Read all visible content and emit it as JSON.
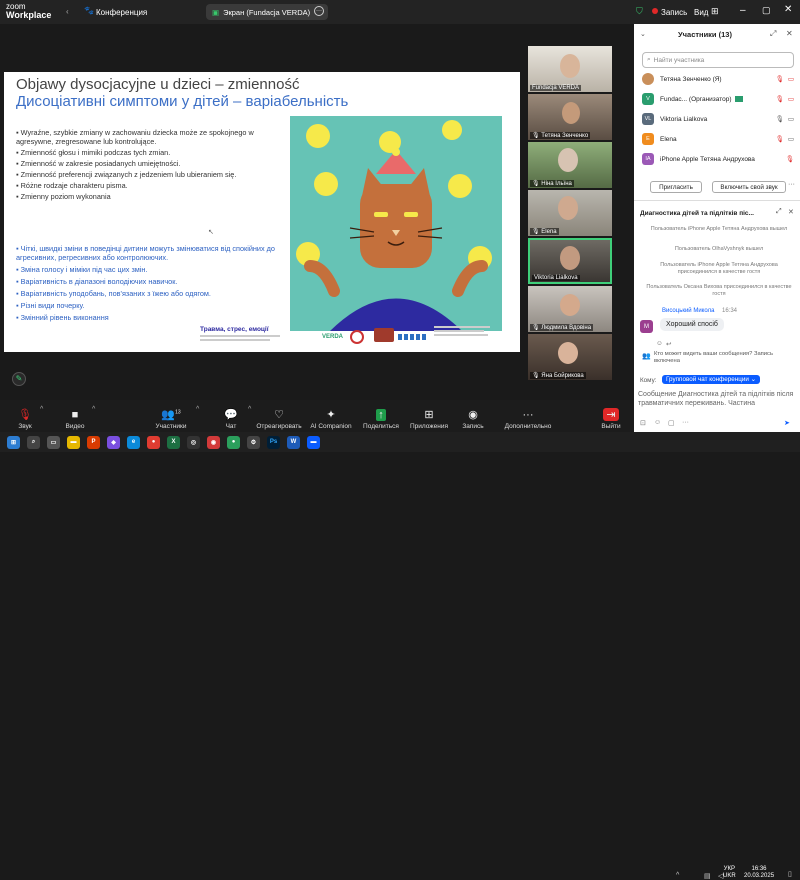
{
  "app": {
    "brand_line1": "zoom",
    "brand_line2": "Workplace",
    "conference_label": "Конференция",
    "share_label": "Экран (Fundacja VERDA)",
    "record_label": "Запись",
    "view_label": "Вид"
  },
  "slide": {
    "title_pl": "Objawy dysocjacyjne u dzieci – zmienność",
    "title_ua": "Дисоціативні симптоми у дітей – варіабельність",
    "bullets_pl": [
      "Wyraźne, szybkie zmiany w zachowaniu dziecka może ze spokojnego w agresywne, zregresowane lub kontrolujące.",
      "Zmienność głosu i mimiki podczas tych zmian.",
      "Zmienność w zakresie posiadanych umiejętności.",
      "Zmienność preferencji związanych z jedzeniem lub ubieraniem się.",
      "Różne rodzaje charakteru pisma.",
      "Zmienny poziom wykonania"
    ],
    "bullets_ua": [
      "Чіткі, швидкі зміни в поведінці дитини можуть змінюватися від спокійних до агресивних, регресивних або контролюючих.",
      "Зміна голосу і міміки під час цих змін.",
      "Варіативність в діапазоні володіючих навичок.",
      "Варіативність уподобань, пов'язаних з їжею або одягом.",
      "Різні види почерку.",
      "Змінний рівень виконання"
    ],
    "footer_title": "Травма, стрес, емоції",
    "verda": "VERDA"
  },
  "strip": [
    {
      "name": "Fundacja VERDA"
    },
    {
      "name": "Тетяна Зенченко"
    },
    {
      "name": "Ніна Ільїна"
    },
    {
      "name": "Elena"
    },
    {
      "name": "Viktoria Lialkova"
    },
    {
      "name": "Людмила Вдовіна"
    },
    {
      "name": "Яна Бойрикова"
    }
  ],
  "participants": {
    "title": "Участники (13)",
    "search_placeholder": "Найти участника",
    "rows": [
      {
        "initials": "",
        "name": "Тетяна Зенченко (Я)",
        "color": "#c98f5a"
      },
      {
        "initials": "V",
        "name": "Fundac... (Организатор)",
        "color": "#2a9d6e"
      },
      {
        "initials": "VL",
        "name": "Viktoria Lialkova",
        "color": "#5a6b7c"
      },
      {
        "initials": "E",
        "name": "Elena",
        "color": "#f08c1e"
      },
      {
        "initials": "IA",
        "name": "iPhone Apple Тетяна Андрухова",
        "color": "#9b59b6"
      }
    ],
    "invite_label": "Пригласить",
    "video_label": "Включить свой звук"
  },
  "chat": {
    "title": "Диагностика дітей та підлітків піс...",
    "system_messages": [
      "Пользователь iPhone Apple Тетяна Андрухова вышел",
      "Пользователь OlhaVyshnyk вышел",
      "Пользователь iPhone Apple Тетяна Андрухова присоединился в качестве гостя",
      "Пользователь Оксана Вихова присоединился в качестве гостя"
    ],
    "sender": "Висоцький Микола",
    "time": "16:34",
    "message": "Хороший спосіб",
    "visibility_note": "Кто может видеть ваши сообщения? Запись включена",
    "to_label": "Кому:",
    "to_value": "Групповой чат конференции",
    "draft": "Сообщение Диагностика дітей та підлітків після травматичних переживань. Частина"
  },
  "toolbar": {
    "audio": "Звук",
    "video": "Видео",
    "participants": "Участники",
    "participants_count": "13",
    "chat": "Чат",
    "react": "Отреагировать",
    "ai": "AI Companion",
    "share": "Поделиться",
    "apps": "Приложения",
    "record": "Запись",
    "more": "Дополнительно",
    "leave": "Выйти"
  },
  "taskbar": {
    "lang1": "УКР",
    "lang2": "UKR",
    "time": "16:36",
    "date": "20.03.2025"
  },
  "colors": {
    "accent": "#0b5cff",
    "muted": "#e02828",
    "slide_blue": "#2d61c2",
    "art_bg": "#66c3b5"
  }
}
